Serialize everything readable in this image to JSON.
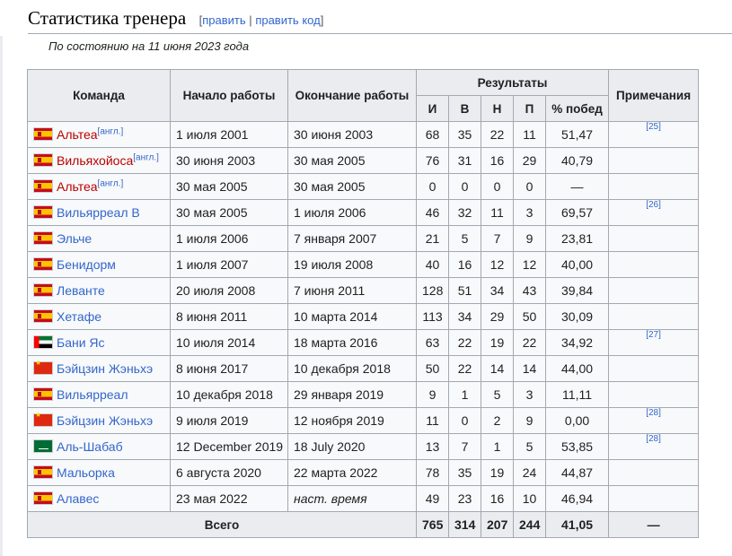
{
  "heading": {
    "title": "Статистика тренера",
    "bracket_open": "[",
    "edit": "править",
    "separator": "|",
    "edit_code": "править код",
    "bracket_close": "]"
  },
  "note": "По состоянию на 11 июня 2023 года",
  "table": {
    "headers": {
      "team": "Команда",
      "start": "Начало работы",
      "end": "Окончание работы",
      "results": "Результаты",
      "notes": "Примечания",
      "played": "И",
      "won": "В",
      "drawn": "Н",
      "lost": "П",
      "win_pct": "% побед"
    },
    "rows": [
      {
        "flag": "es",
        "team": "Альтеа",
        "red": true,
        "sup": "[англ.]",
        "start": "1 июля 2001",
        "end": "30 июня 2003",
        "end_italic": false,
        "p": "68",
        "w": "35",
        "d": "22",
        "l": "11",
        "pct": "51,47",
        "ref": "[25]"
      },
      {
        "flag": "es",
        "team": "Вильяхойоса",
        "red": true,
        "sup": "[англ.]",
        "start": "30 июня 2003",
        "end": "30 мая 2005",
        "end_italic": false,
        "p": "76",
        "w": "31",
        "d": "16",
        "l": "29",
        "pct": "40,79",
        "ref": ""
      },
      {
        "flag": "es",
        "team": "Альтеа",
        "red": true,
        "sup": "[англ.]",
        "start": "30 мая 2005",
        "end": "30 мая 2005",
        "end_italic": false,
        "p": "0",
        "w": "0",
        "d": "0",
        "l": "0",
        "pct": "—",
        "ref": ""
      },
      {
        "flag": "es",
        "team": "Вильярреал B",
        "red": false,
        "sup": "",
        "start": "30 мая 2005",
        "end": "1 июля 2006",
        "end_italic": false,
        "p": "46",
        "w": "32",
        "d": "11",
        "l": "3",
        "pct": "69,57",
        "ref": "[26]"
      },
      {
        "flag": "es",
        "team": "Эльче",
        "red": false,
        "sup": "",
        "start": "1 июля 2006",
        "end": "7 января 2007",
        "end_italic": false,
        "p": "21",
        "w": "5",
        "d": "7",
        "l": "9",
        "pct": "23,81",
        "ref": ""
      },
      {
        "flag": "es",
        "team": "Бенидорм",
        "red": false,
        "sup": "",
        "start": "1 июля 2007",
        "end": "19 июля 2008",
        "end_italic": false,
        "p": "40",
        "w": "16",
        "d": "12",
        "l": "12",
        "pct": "40,00",
        "ref": ""
      },
      {
        "flag": "es",
        "team": "Леванте",
        "red": false,
        "sup": "",
        "start": "20 июля 2008",
        "end": "7 июня 2011",
        "end_italic": false,
        "p": "128",
        "w": "51",
        "d": "34",
        "l": "43",
        "pct": "39,84",
        "ref": ""
      },
      {
        "flag": "es",
        "team": "Хетафе",
        "red": false,
        "sup": "",
        "start": "8 июня 2011",
        "end": "10 марта 2014",
        "end_italic": false,
        "p": "113",
        "w": "34",
        "d": "29",
        "l": "50",
        "pct": "30,09",
        "ref": ""
      },
      {
        "flag": "ae",
        "team": "Бани Яс",
        "red": false,
        "sup": "",
        "start": "10 июля 2014",
        "end": "18 марта 2016",
        "end_italic": false,
        "p": "63",
        "w": "22",
        "d": "19",
        "l": "22",
        "pct": "34,92",
        "ref": "[27]"
      },
      {
        "flag": "cn",
        "team": "Бэйцзин Жэньхэ",
        "red": false,
        "sup": "",
        "start": "8 июня 2017",
        "end": "10 декабря 2018",
        "end_italic": false,
        "p": "50",
        "w": "22",
        "d": "14",
        "l": "14",
        "pct": "44,00",
        "ref": ""
      },
      {
        "flag": "es",
        "team": "Вильярреал",
        "red": false,
        "sup": "",
        "start": "10 декабря 2018",
        "end": "29 января 2019",
        "end_italic": false,
        "p": "9",
        "w": "1",
        "d": "5",
        "l": "3",
        "pct": "11,11",
        "ref": ""
      },
      {
        "flag": "cn",
        "team": "Бэйцзин Жэньхэ",
        "red": false,
        "sup": "",
        "start": "9 июля 2019",
        "end": "12 ноября 2019",
        "end_italic": false,
        "p": "11",
        "w": "0",
        "d": "2",
        "l": "9",
        "pct": "0,00",
        "ref": "[28]"
      },
      {
        "flag": "sa",
        "team": "Аль-Шабаб",
        "red": false,
        "sup": "",
        "start": "12 December 2019",
        "end": "18 July 2020",
        "end_italic": false,
        "p": "13",
        "w": "7",
        "d": "1",
        "l": "5",
        "pct": "53,85",
        "ref": "[28]"
      },
      {
        "flag": "es",
        "team": "Мальорка",
        "red": false,
        "sup": "",
        "start": "6 августа 2020",
        "end": "22 марта 2022",
        "end_italic": false,
        "p": "78",
        "w": "35",
        "d": "19",
        "l": "24",
        "pct": "44,87",
        "ref": ""
      },
      {
        "flag": "es",
        "team": "Алавес",
        "red": false,
        "sup": "",
        "start": "23 мая 2022",
        "end": "наст. время",
        "end_italic": true,
        "p": "49",
        "w": "23",
        "d": "16",
        "l": "10",
        "pct": "46,94",
        "ref": ""
      }
    ],
    "total": {
      "label": "Всего",
      "p": "765",
      "w": "314",
      "d": "207",
      "l": "244",
      "pct": "41,05",
      "notes": "—"
    }
  },
  "colors": {
    "link": "#3366cc",
    "redlink": "#ba0000",
    "header_bg": "#eaecf0",
    "border": "#a2a9b1"
  }
}
